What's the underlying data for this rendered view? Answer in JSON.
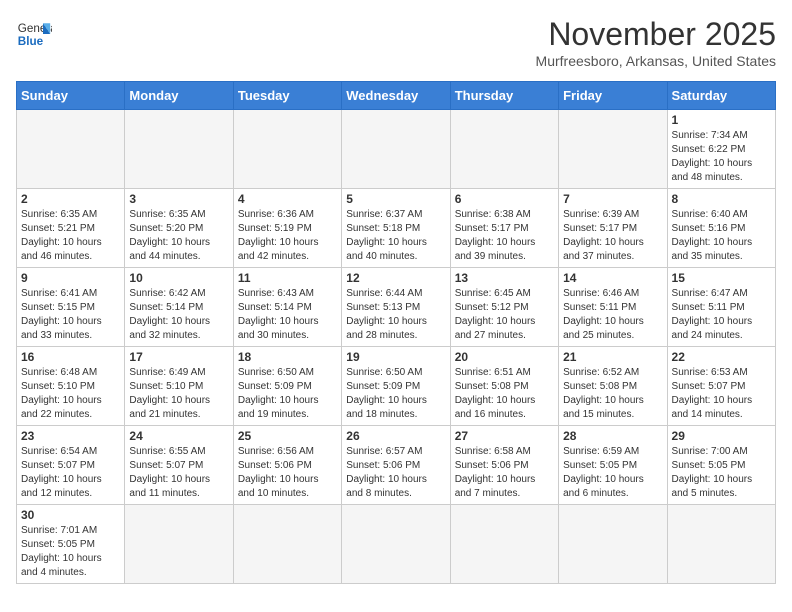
{
  "header": {
    "logo_line1": "General",
    "logo_line2": "Blue",
    "month": "November 2025",
    "location": "Murfreesboro, Arkansas, United States"
  },
  "days_of_week": [
    "Sunday",
    "Monday",
    "Tuesday",
    "Wednesday",
    "Thursday",
    "Friday",
    "Saturday"
  ],
  "weeks": [
    [
      {
        "day": "",
        "info": ""
      },
      {
        "day": "",
        "info": ""
      },
      {
        "day": "",
        "info": ""
      },
      {
        "day": "",
        "info": ""
      },
      {
        "day": "",
        "info": ""
      },
      {
        "day": "",
        "info": ""
      },
      {
        "day": "1",
        "info": "Sunrise: 7:34 AM\nSunset: 6:22 PM\nDaylight: 10 hours and 48 minutes."
      }
    ],
    [
      {
        "day": "2",
        "info": "Sunrise: 6:35 AM\nSunset: 5:21 PM\nDaylight: 10 hours and 46 minutes."
      },
      {
        "day": "3",
        "info": "Sunrise: 6:35 AM\nSunset: 5:20 PM\nDaylight: 10 hours and 44 minutes."
      },
      {
        "day": "4",
        "info": "Sunrise: 6:36 AM\nSunset: 5:19 PM\nDaylight: 10 hours and 42 minutes."
      },
      {
        "day": "5",
        "info": "Sunrise: 6:37 AM\nSunset: 5:18 PM\nDaylight: 10 hours and 40 minutes."
      },
      {
        "day": "6",
        "info": "Sunrise: 6:38 AM\nSunset: 5:17 PM\nDaylight: 10 hours and 39 minutes."
      },
      {
        "day": "7",
        "info": "Sunrise: 6:39 AM\nSunset: 5:17 PM\nDaylight: 10 hours and 37 minutes."
      },
      {
        "day": "8",
        "info": "Sunrise: 6:40 AM\nSunset: 5:16 PM\nDaylight: 10 hours and 35 minutes."
      }
    ],
    [
      {
        "day": "9",
        "info": "Sunrise: 6:41 AM\nSunset: 5:15 PM\nDaylight: 10 hours and 33 minutes."
      },
      {
        "day": "10",
        "info": "Sunrise: 6:42 AM\nSunset: 5:14 PM\nDaylight: 10 hours and 32 minutes."
      },
      {
        "day": "11",
        "info": "Sunrise: 6:43 AM\nSunset: 5:14 PM\nDaylight: 10 hours and 30 minutes."
      },
      {
        "day": "12",
        "info": "Sunrise: 6:44 AM\nSunset: 5:13 PM\nDaylight: 10 hours and 28 minutes."
      },
      {
        "day": "13",
        "info": "Sunrise: 6:45 AM\nSunset: 5:12 PM\nDaylight: 10 hours and 27 minutes."
      },
      {
        "day": "14",
        "info": "Sunrise: 6:46 AM\nSunset: 5:11 PM\nDaylight: 10 hours and 25 minutes."
      },
      {
        "day": "15",
        "info": "Sunrise: 6:47 AM\nSunset: 5:11 PM\nDaylight: 10 hours and 24 minutes."
      }
    ],
    [
      {
        "day": "16",
        "info": "Sunrise: 6:48 AM\nSunset: 5:10 PM\nDaylight: 10 hours and 22 minutes."
      },
      {
        "day": "17",
        "info": "Sunrise: 6:49 AM\nSunset: 5:10 PM\nDaylight: 10 hours and 21 minutes."
      },
      {
        "day": "18",
        "info": "Sunrise: 6:50 AM\nSunset: 5:09 PM\nDaylight: 10 hours and 19 minutes."
      },
      {
        "day": "19",
        "info": "Sunrise: 6:50 AM\nSunset: 5:09 PM\nDaylight: 10 hours and 18 minutes."
      },
      {
        "day": "20",
        "info": "Sunrise: 6:51 AM\nSunset: 5:08 PM\nDaylight: 10 hours and 16 minutes."
      },
      {
        "day": "21",
        "info": "Sunrise: 6:52 AM\nSunset: 5:08 PM\nDaylight: 10 hours and 15 minutes."
      },
      {
        "day": "22",
        "info": "Sunrise: 6:53 AM\nSunset: 5:07 PM\nDaylight: 10 hours and 14 minutes."
      }
    ],
    [
      {
        "day": "23",
        "info": "Sunrise: 6:54 AM\nSunset: 5:07 PM\nDaylight: 10 hours and 12 minutes."
      },
      {
        "day": "24",
        "info": "Sunrise: 6:55 AM\nSunset: 5:07 PM\nDaylight: 10 hours and 11 minutes."
      },
      {
        "day": "25",
        "info": "Sunrise: 6:56 AM\nSunset: 5:06 PM\nDaylight: 10 hours and 10 minutes."
      },
      {
        "day": "26",
        "info": "Sunrise: 6:57 AM\nSunset: 5:06 PM\nDaylight: 10 hours and 8 minutes."
      },
      {
        "day": "27",
        "info": "Sunrise: 6:58 AM\nSunset: 5:06 PM\nDaylight: 10 hours and 7 minutes."
      },
      {
        "day": "28",
        "info": "Sunrise: 6:59 AM\nSunset: 5:05 PM\nDaylight: 10 hours and 6 minutes."
      },
      {
        "day": "29",
        "info": "Sunrise: 7:00 AM\nSunset: 5:05 PM\nDaylight: 10 hours and 5 minutes."
      }
    ],
    [
      {
        "day": "30",
        "info": "Sunrise: 7:01 AM\nSunset: 5:05 PM\nDaylight: 10 hours and 4 minutes."
      },
      {
        "day": "",
        "info": ""
      },
      {
        "day": "",
        "info": ""
      },
      {
        "day": "",
        "info": ""
      },
      {
        "day": "",
        "info": ""
      },
      {
        "day": "",
        "info": ""
      },
      {
        "day": "",
        "info": ""
      }
    ]
  ]
}
